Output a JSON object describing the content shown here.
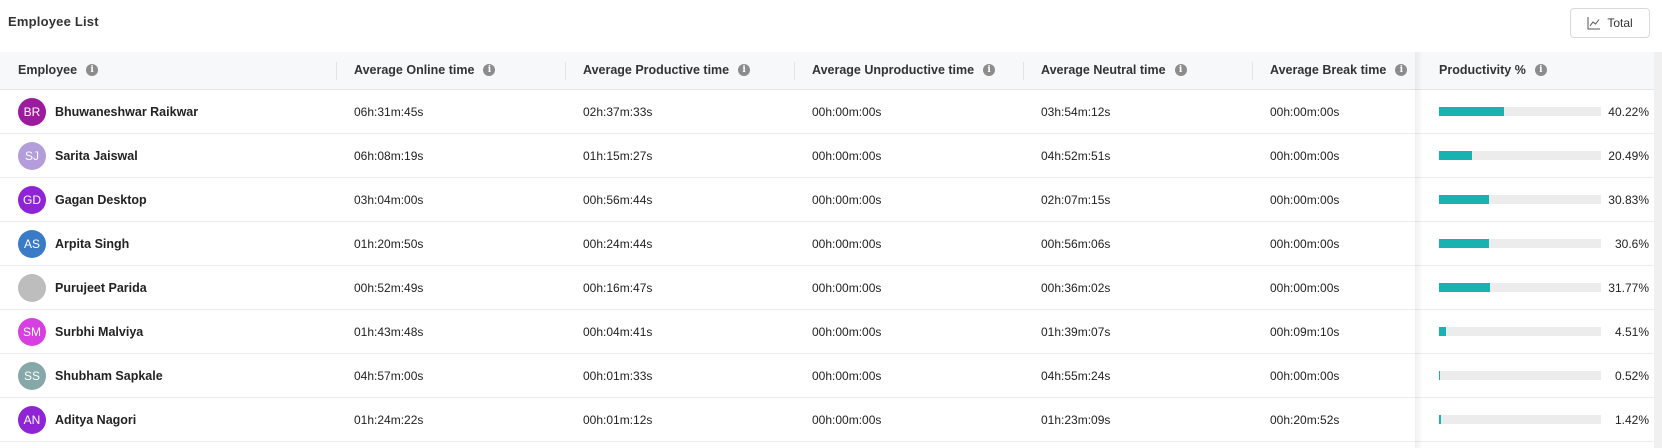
{
  "header": {
    "title": "Employee List",
    "total_button": {
      "label": "Total",
      "icon": "line-chart-icon"
    }
  },
  "colors": {
    "bar_fill": "#18b2b1",
    "bar_track": "#ececec",
    "header_bg": "#f7f8fa"
  },
  "columns": [
    {
      "label": "Employee",
      "info_icon": "info-icon"
    },
    {
      "label": "Average Online time",
      "info_icon": "info-icon"
    },
    {
      "label": "Average Productive time",
      "info_icon": "info-icon"
    },
    {
      "label": "Average Unproductive time",
      "info_icon": "info-icon"
    },
    {
      "label": "Average Neutral time",
      "info_icon": "info-icon"
    },
    {
      "label": "Average Break time",
      "info_icon": "info-icon"
    },
    {
      "label": "Productivity %",
      "info_icon": "info-icon"
    }
  ],
  "rows": [
    {
      "initials": "BR",
      "avatar_color": "#9c1a9e",
      "name": "Bhuwaneshwar Raikwar",
      "online": "06h:31m:45s",
      "productive": "02h:37m:33s",
      "unproductive": "00h:00m:00s",
      "neutral": "03h:54m:12s",
      "break": "00h:00m:00s",
      "productivity": "40.22%",
      "productivity_value": 40.22
    },
    {
      "initials": "SJ",
      "avatar_color": "#b39ddb",
      "name": "Sarita Jaiswal",
      "online": "06h:08m:19s",
      "productive": "01h:15m:27s",
      "unproductive": "00h:00m:00s",
      "neutral": "04h:52m:51s",
      "break": "00h:00m:00s",
      "productivity": "20.49%",
      "productivity_value": 20.49
    },
    {
      "initials": "GD",
      "avatar_color": "#8e24d6",
      "name": "Gagan Desktop",
      "online": "03h:04m:00s",
      "productive": "00h:56m:44s",
      "unproductive": "00h:00m:00s",
      "neutral": "02h:07m:15s",
      "break": "00h:00m:00s",
      "productivity": "30.83%",
      "productivity_value": 30.83
    },
    {
      "initials": "AS",
      "avatar_color": "#3a7bc8",
      "name": "Arpita Singh",
      "online": "01h:20m:50s",
      "productive": "00h:24m:44s",
      "unproductive": "00h:00m:00s",
      "neutral": "00h:56m:06s",
      "break": "00h:00m:00s",
      "productivity": "30.6%",
      "productivity_value": 30.6
    },
    {
      "initials": "",
      "avatar_color": "#bdbdbd",
      "name": "Purujeet Parida",
      "online": "00h:52m:49s",
      "productive": "00h:16m:47s",
      "unproductive": "00h:00m:00s",
      "neutral": "00h:36m:02s",
      "break": "00h:00m:00s",
      "productivity": "31.77%",
      "productivity_value": 31.77
    },
    {
      "initials": "SM",
      "avatar_color": "#d83fe0",
      "name": "Surbhi Malviya",
      "online": "01h:43m:48s",
      "productive": "00h:04m:41s",
      "unproductive": "00h:00m:00s",
      "neutral": "01h:39m:07s",
      "break": "00h:09m:10s",
      "productivity": "4.51%",
      "productivity_value": 4.51
    },
    {
      "initials": "SS",
      "avatar_color": "#86a8a8",
      "name": "Shubham Sapkale",
      "online": "04h:57m:00s",
      "productive": "00h:01m:33s",
      "unproductive": "00h:00m:00s",
      "neutral": "04h:55m:24s",
      "break": "00h:00m:00s",
      "productivity": "0.52%",
      "productivity_value": 0.52
    },
    {
      "initials": "AN",
      "avatar_color": "#8e24d6",
      "name": "Aditya Nagori",
      "online": "01h:24m:22s",
      "productive": "00h:01m:12s",
      "unproductive": "00h:00m:00s",
      "neutral": "01h:23m:09s",
      "break": "00h:20m:52s",
      "productivity": "1.42%",
      "productivity_value": 1.42
    }
  ]
}
